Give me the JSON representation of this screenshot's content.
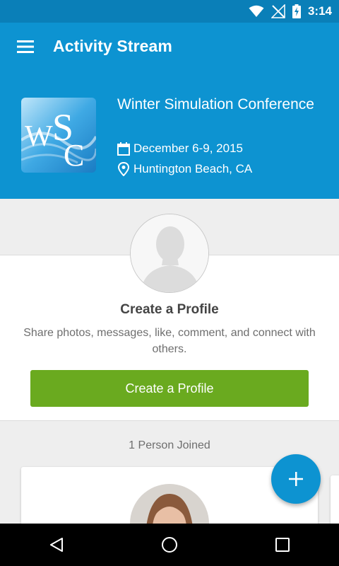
{
  "status_bar": {
    "time": "3:14"
  },
  "app_bar": {
    "title": "Activity Stream"
  },
  "event": {
    "name": "Winter Simulation Conference",
    "logo_text": "WSC",
    "date": "December 6-9, 2015",
    "location": "Huntington Beach, CA"
  },
  "profile_card": {
    "title": "Create a Profile",
    "description": "Share photos, messages, like, comment, and connect with others.",
    "button_label": "Create a Profile"
  },
  "members": {
    "joined_text": "1 Person Joined"
  },
  "icons": {
    "menu": "menu-icon",
    "calendar": "calendar-icon",
    "location": "location-pin-icon",
    "fab": "plus-icon",
    "back": "back-icon",
    "home": "home-icon",
    "recents": "recents-icon"
  },
  "colors": {
    "primary": "#0d93d1",
    "status_bar": "#0a7fb8",
    "accent_button": "#6aaa1f",
    "background": "#eeeeee"
  }
}
